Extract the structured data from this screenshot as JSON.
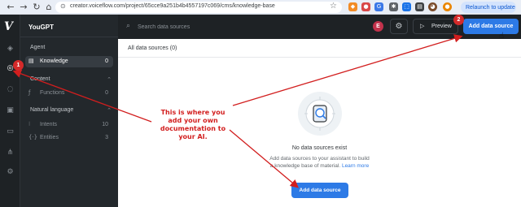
{
  "browser": {
    "url": "creator.voiceflow.com/project/65cce9a251b4b4557197c069/cms/knowledge-base",
    "relaunch_label": "Relaunch to update",
    "relaunch_icon": "more-vert-icon"
  },
  "app": {
    "project_name": "YouGPT",
    "search_placeholder": "Search data sources",
    "avatar_initial": "E",
    "preview_label": "Preview",
    "add_button_label": "Add data source"
  },
  "sidebar": {
    "sections": [
      {
        "header": "Agent",
        "items": [
          {
            "label": "Knowledge",
            "count": "0",
            "icon": "book-icon",
            "active": true
          }
        ]
      },
      {
        "header": "Content",
        "items": [
          {
            "label": "Functions",
            "count": "0",
            "icon": "function-icon"
          }
        ]
      },
      {
        "header": "Natural language",
        "items": [
          {
            "label": "Intents",
            "count": "10",
            "icon": "intent-icon"
          },
          {
            "label": "Entities",
            "count": "3",
            "icon": "entity-icon"
          }
        ]
      }
    ]
  },
  "main": {
    "header": "All data sources (0)",
    "empty_title": "No data sources exist",
    "empty_desc": "Add data sources to your assistant to build a knowledge base of material.",
    "learn_more": "Learn more",
    "add_button_label": "Add data source"
  },
  "annotation": {
    "text": "This is where you add your own documentation to your AI.",
    "badge1": "1",
    "badge2": "2",
    "color": "#d21e1e"
  }
}
